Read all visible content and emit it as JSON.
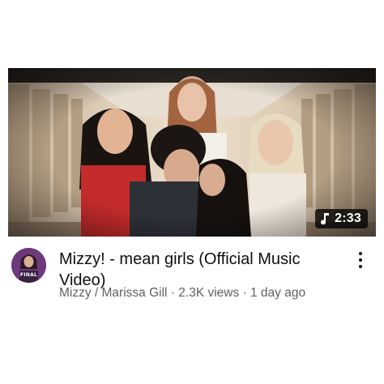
{
  "video": {
    "title": "Mizzy! - mean girls (Official Music Video)",
    "duration": "2:33",
    "channel": "Mizzy / Marissa Gill",
    "separator": " · ",
    "views": "2.3K views",
    "age": "1 day ago",
    "avatar_text": "FINAL"
  },
  "icons": {
    "duration": "music-note-icon",
    "menu": "more-vert-icon"
  },
  "colors": {
    "title": "#0f0f0f",
    "meta": "#606060",
    "badge_bg": "#000000",
    "badge_text": "#ffffff"
  }
}
